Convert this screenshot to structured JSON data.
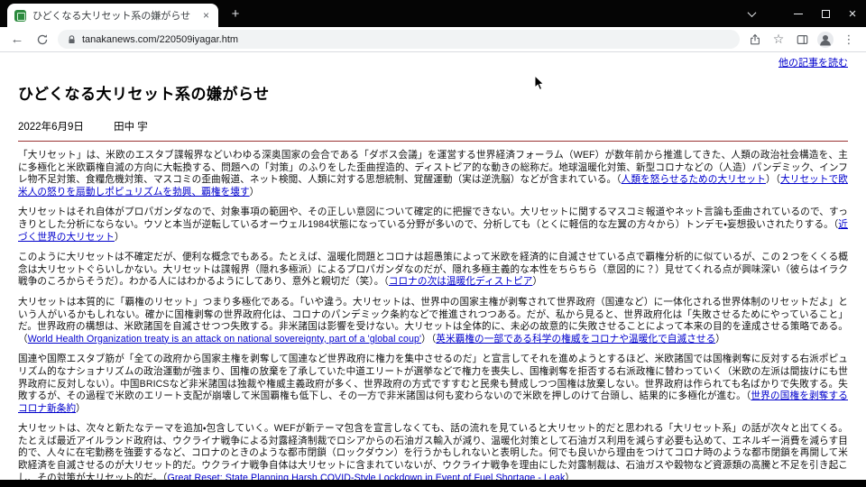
{
  "window": {
    "tab_title": "ひどくなる大リセット系の嫌がらせ",
    "url": "tanakanews.com/220509iyagar.htm"
  },
  "icons": {
    "back": "←",
    "new_tab": "+",
    "close_tab": "×",
    "close_window": "×",
    "star": "☆",
    "kebab": "⋮"
  },
  "page": {
    "top_link": "他の記事を読む",
    "title": "ひどくなる大リセット系の嫌がらせ",
    "date": "2022年6月9日",
    "author": "田中 宇",
    "link_color": "#0000cc",
    "rule_color": "#993333",
    "paragraphs": [
      {
        "segments": [
          {
            "t": "「大リセット」は、米欧のエスタブ諜報界などいわゆる深奥国家の会合である「ダボス会議」を運営する世界経済フォーラム（WEF）が数年前から推進してきた、人類の政治社会構造を、主に多極化と米欧覇権自滅の方向に大転換する、問題への「対策」のふりをした歪曲捏造的、ディストピア的な動きの総称だ。地球温暖化対策、新型コロナなどの（人造）パンデミック、インフレ物不足対策、食糧危機対策、マスコミの歪曲報道、ネット検閲、人類に対する思想統制、覚醒運動（実は逆洗脳）などが含まれている。（"
          },
          {
            "t": "人類を怒らせるための大リセット",
            "link": true
          },
          {
            "t": "）（"
          },
          {
            "t": "大リセットで欧米人の怒りを扇動しポピュリズムを勃興、覇権を壊す",
            "link": true
          },
          {
            "t": "）"
          }
        ]
      },
      {
        "segments": [
          {
            "t": "大リセットはそれ自体がプロパガンダなので、対象事項の範囲や、その正しい意図について確定的に把握できない。大リセットに関するマスコミ報道やネット言論も歪曲されているので、すっきりとした分析にならない。ウソと本当が逆転しているオーウェル1984状態になっている分野が多いので、分析しても（とくに軽信的な左翼の方々から）トンデモ・妄想扱いされたりする。（"
          },
          {
            "t": "近づく世界の大リセット",
            "link": true
          },
          {
            "t": "）"
          }
        ]
      },
      {
        "segments": [
          {
            "t": "このように大リセットは不確定だが、便利な概念でもある。たとえば、温暖化問題とコロナは超愚策によって米欧を経済的に自滅させている点で覇権分析的に似ているが、この２つをくくる概念は大リセットぐらいしかない。大リセットは諜報界（隠れ多極派）によるプロパガンダなのだが、隠れ多極主義的な本性をちらちら（意図的に？）見せてくれる点が興味深い（彼らはイラク戦争のころからそうだ）。わかる人にはわかるようにしてあり、意外と親切だ（笑）。（"
          },
          {
            "t": "コロナの次は温暖化ディストピア",
            "link": true
          },
          {
            "t": "）"
          }
        ]
      },
      {
        "segments": [
          {
            "t": "大リセットは本質的に「覇権のリセット」つまり多極化である。「いや違う。大リセットは、世界中の国家主権が剥奪されて世界政府（国連など）に一体化される世界体制のリセットだよ」という人がいるかもしれない。確かに国権剥奪の世界政府化は、コロナのパンデミック条約などで推進されつつある。だが、私から見ると、世界政府化は「失敗させるためにやっていること」だ。世界政府の構想は、米欧諸国を自滅させつつ失敗する。非米諸国は影響を受けない。大リセットは全体的に、未必の故意的に失敗させることによって本来の目的を達成させる策略である。（"
          },
          {
            "t": "World Health Organization treaty is an attack on national sovereignty, part of a 'global coup'",
            "link": true
          },
          {
            "t": "）（"
          },
          {
            "t": "英米覇権の一部である科学の権威をコロナや温暖化で自滅させる",
            "link": true
          },
          {
            "t": "）"
          }
        ]
      },
      {
        "segments": [
          {
            "t": "国連や国際エスタブ筋が「全ての政府から国家主権を剥奪して国連など世界政府に権力を集中させるのだ」と宣言してそれを進めようとするほど、米欧諸国では国権剥奪に反対する右派ポピュリズム的なナショナリズムの政治運動が強まり、国権の放棄を了承していた中道エリートが選挙などで権力を喪失し、国権剥奪を拒否する右派政権に替わっていく（米欧の左派は間抜けにも世界政府に反対しない）。中国BRICSなど非米諸国は独裁や権威主義政府が多く、世界政府の方式ですすむと民衆も賛成しつつ国権は放棄しない。世界政府は作られても名ばかりで失敗する。失敗するが、その過程で米欧のエリート支配が崩壊して米国覇権も低下し、その一方で非米諸国は何も変わらないので米欧を押しのけて台頭し、結果的に多極化が進む。（"
          },
          {
            "t": "世界の国権を剥奪するコロナ新条約",
            "link": true
          },
          {
            "t": "）"
          }
        ]
      },
      {
        "segments": [
          {
            "t": "大リセットは、次々と新たなテーマを追加・包含していく。WEFが新テーマ包含を宣言しなくても、話の流れを見ていると大リセット的だと思われる「大リセット系」の話が次々と出てくる。たとえば最近アイルランド政府は、ウクライナ戦争による対露経済制裁でロシアからの石油ガス輸入が減り、温暖化対策として石油ガス利用を減らす必要も込めて、エネルギー消費を減らす目的で、人々に在宅勤務を強要するなど、コロナのときのような都市閉鎖（ロックダウン）を行うかもしれないと表明した。何でも良いから理由をつけてコロナ時のような都市閉鎖を再開して米欧経済を自滅させるのが大リセット的だ。ウクライナ戦争自体は大リセットに含まれていないが、ウクライナ戦争を理由にした対露制裁は、石油ガスや穀物など資源類の高騰と不足を引き起こし、その対策が大リセット的だ。（"
          },
          {
            "t": "Great Reset: State Planning Harsh COVID-Style Lockdown in Event of Fuel Shortage - Leak",
            "link": true
          },
          {
            "t": "）"
          }
        ]
      }
    ]
  }
}
